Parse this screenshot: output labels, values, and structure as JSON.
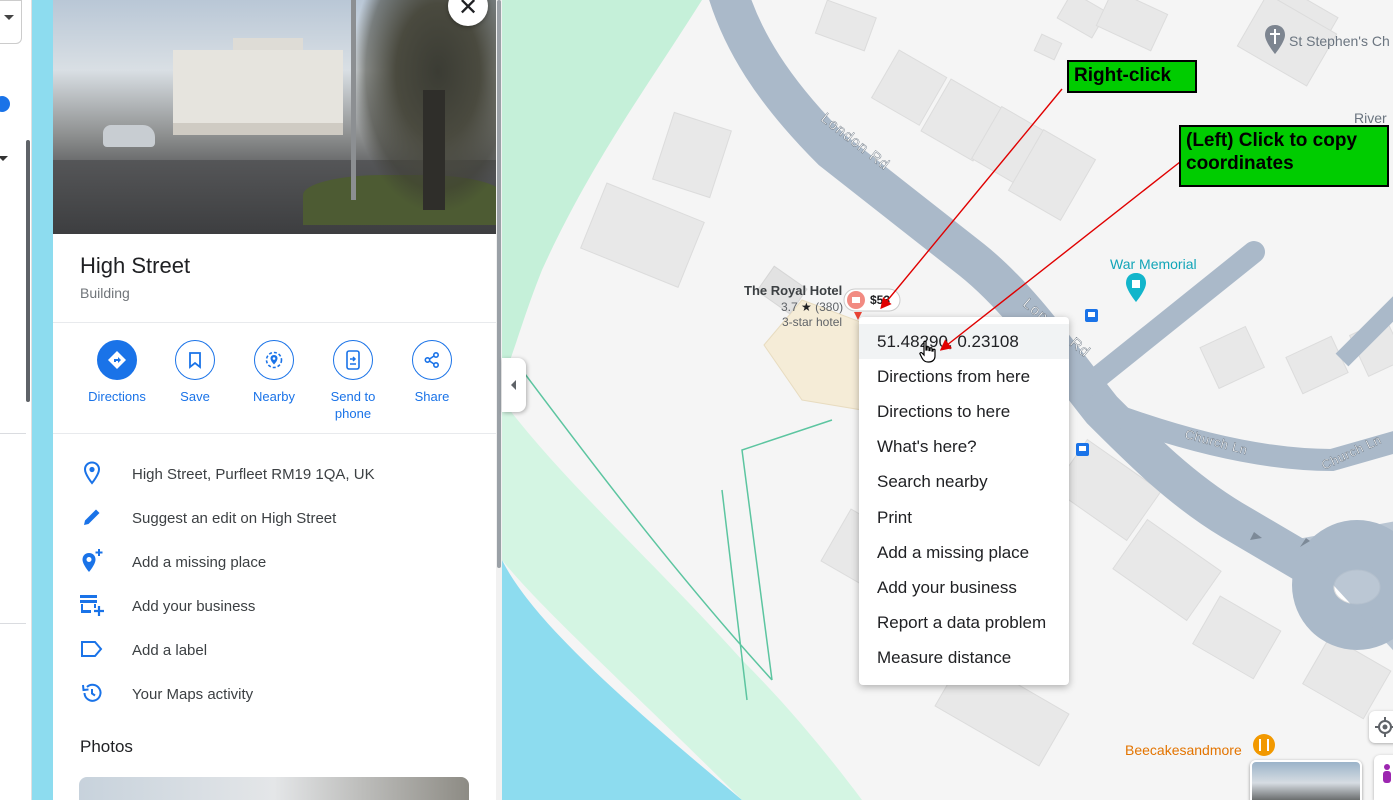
{
  "place": {
    "title": "High Street",
    "type": "Building",
    "close_glyph": "✕"
  },
  "actions": [
    {
      "label": "Directions",
      "icon": "directions-icon"
    },
    {
      "label": "Save",
      "icon": "bookmark-icon"
    },
    {
      "label": "Nearby",
      "icon": "nearby-icon"
    },
    {
      "label": "Send to phone",
      "icon": "send-to-phone-icon"
    },
    {
      "label": "Share",
      "icon": "share-icon"
    }
  ],
  "info_rows": [
    {
      "text": "High Street, Purfleet RM19 1QA, UK",
      "icon": "location-pin-icon"
    },
    {
      "text": "Suggest an edit on High Street",
      "icon": "pencil-icon"
    },
    {
      "text": "Add a missing place",
      "icon": "add-place-icon"
    },
    {
      "text": "Add your business",
      "icon": "add-business-icon"
    },
    {
      "text": "Add a label",
      "icon": "label-icon"
    },
    {
      "text": "Your Maps activity",
      "icon": "history-icon"
    }
  ],
  "photos": {
    "title": "Photos"
  },
  "map": {
    "roads": [
      "London Rd",
      "London Rd",
      "Church Ln",
      "Church Ln"
    ],
    "places": {
      "church": "St Stephen's Ch",
      "river": "River",
      "war_memorial": "War Memorial",
      "bakery": "Beecakesandmore"
    },
    "hotel": {
      "name": "The Royal Hotel",
      "rating": "3.7",
      "star": "★",
      "reviews": "(380)",
      "class": "3-star hotel",
      "price": "$53"
    }
  },
  "context_menu": {
    "items": [
      "51.48290, 0.23108",
      "Directions from here",
      "Directions to here",
      "What's here?",
      "Search nearby",
      "Print",
      "Add a missing place",
      "Add your business",
      "Report a data problem",
      "Measure distance"
    ]
  },
  "annotations": {
    "right_click": "Right-click",
    "left_click": "(Left) Click to copy coordinates",
    "highlight_color": "#00cc00",
    "arrow_color": "#e00000"
  },
  "colors": {
    "accent": "#1a73e8",
    "road": "#aab9c9",
    "water": "#8ddcef",
    "park": "#c5f0d9"
  }
}
